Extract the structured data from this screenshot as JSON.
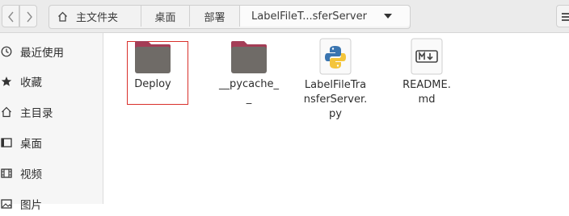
{
  "breadcrumbs": {
    "home": "主文件夹",
    "item2": "桌面",
    "item3": "部署",
    "current": "LabelFileT...sferServer"
  },
  "sidebar": {
    "items": [
      {
        "label": "最近使用",
        "icon": "clock-icon"
      },
      {
        "label": "收藏",
        "icon": "star-icon"
      },
      {
        "label": "主目录",
        "icon": "home-icon"
      },
      {
        "label": "桌面",
        "icon": "desktop-icon"
      },
      {
        "label": "视频",
        "icon": "film-icon"
      },
      {
        "label": "图片",
        "icon": "image-icon"
      }
    ]
  },
  "files": [
    {
      "name": "Deploy",
      "type": "folder",
      "selected": true
    },
    {
      "name": "__pycache__",
      "type": "folder"
    },
    {
      "name": "LabelFileTransferServer.py",
      "type": "python"
    },
    {
      "name": "README.md",
      "type": "markdown"
    }
  ],
  "colors": {
    "folder_body": "#6f6b67",
    "folder_tab": "#a43d56",
    "selection": "#d9302b"
  }
}
